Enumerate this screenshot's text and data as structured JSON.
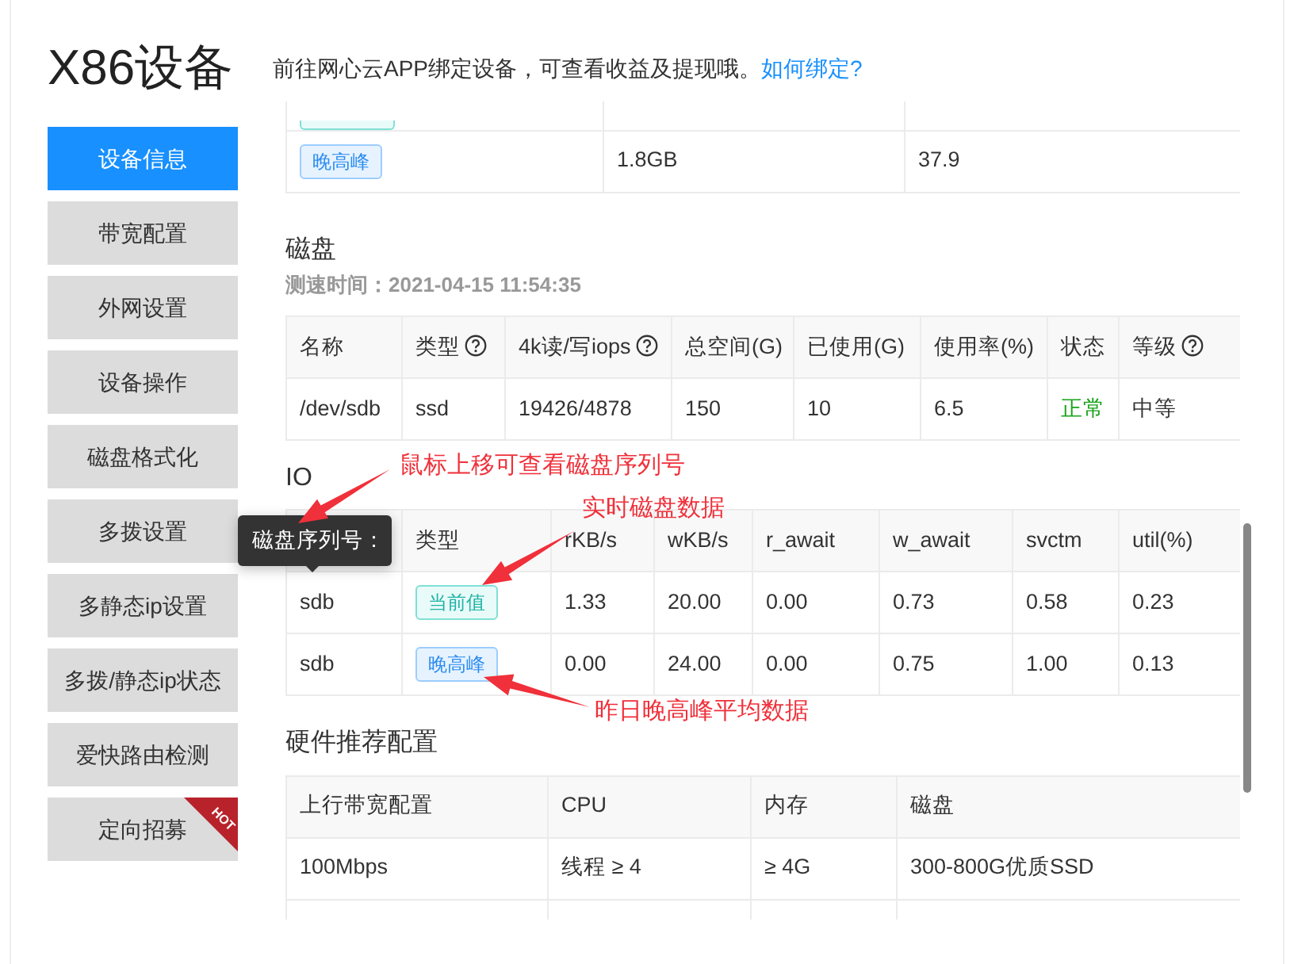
{
  "title": "X86设备",
  "notice": {
    "text": "前往网心云APP绑定设备，可查看收益及提现哦。",
    "link": "如何绑定?"
  },
  "sidebar": {
    "items": [
      {
        "label": "设备信息",
        "selected": true
      },
      {
        "label": "带宽配置",
        "selected": false
      },
      {
        "label": "外网设置",
        "selected": false
      },
      {
        "label": "设备操作",
        "selected": false
      },
      {
        "label": "磁盘格式化",
        "selected": false
      },
      {
        "label": "多拨设置",
        "selected": false
      },
      {
        "label": "多静态ip设置",
        "selected": false
      },
      {
        "label": "多拨/静态ip状态",
        "selected": false
      },
      {
        "label": "爱快路由检测",
        "selected": false
      },
      {
        "label": "定向招募",
        "selected": false,
        "ribbon": "HOT"
      }
    ]
  },
  "traffic_table": {
    "cut_row": {
      "tag": {
        "kind": "current"
      }
    },
    "rows": [
      {
        "tag": {
          "label": "晚高峰",
          "kind": "peak"
        },
        "column_2": "1.8GB",
        "column_3": "37.9"
      }
    ]
  },
  "disk": {
    "title": "磁盘",
    "test_time": "测速时间：2021-04-15 11:54:35",
    "columns": [
      {
        "label": "名称",
        "help": false
      },
      {
        "label": "类型",
        "help": true
      },
      {
        "label": "4k读/写iops",
        "help": true
      },
      {
        "label": "总空间(G)",
        "help": false
      },
      {
        "label": "已使用(G)",
        "help": false
      },
      {
        "label": "使用率(%)",
        "help": false
      },
      {
        "label": "状态",
        "help": false
      },
      {
        "label": "等级",
        "help": true
      }
    ],
    "rows": [
      {
        "cells": [
          "/dev/sdb",
          "ssd",
          "19426/4878",
          "150",
          "10",
          "6.5"
        ],
        "status": "正常",
        "healthy": true,
        "grade": "中等"
      }
    ]
  },
  "io": {
    "title": "IO",
    "tooltip": "磁盘序列号：",
    "columns": [
      "类型",
      "rKB/s",
      "wKB/s",
      "r_await",
      "w_await",
      "svctm",
      "util(%)"
    ],
    "rows": [
      {
        "name": "sdb",
        "tag": {
          "label": "当前值",
          "kind": "current"
        },
        "values": [
          "1.33",
          "20.00",
          "0.00",
          "0.73",
          "0.58",
          "0.23"
        ]
      },
      {
        "name": "sdb",
        "tag": {
          "label": "晚高峰",
          "kind": "peak"
        },
        "values": [
          "0.00",
          "24.00",
          "0.00",
          "0.75",
          "1.00",
          "0.13"
        ]
      }
    ]
  },
  "annotations": [
    {
      "text": "鼠标上移可查看磁盘序列号"
    },
    {
      "text": "实时磁盘数据"
    },
    {
      "text": "昨日晚高峰平均数据"
    }
  ],
  "hardware": {
    "title": "硬件推荐配置",
    "columns": [
      "上行带宽配置",
      "CPU",
      "内存",
      "磁盘"
    ],
    "rows": [
      [
        "100Mbps",
        "线程 ≥ 4",
        "≥ 4G",
        "300-800G优质SSD"
      ]
    ]
  }
}
